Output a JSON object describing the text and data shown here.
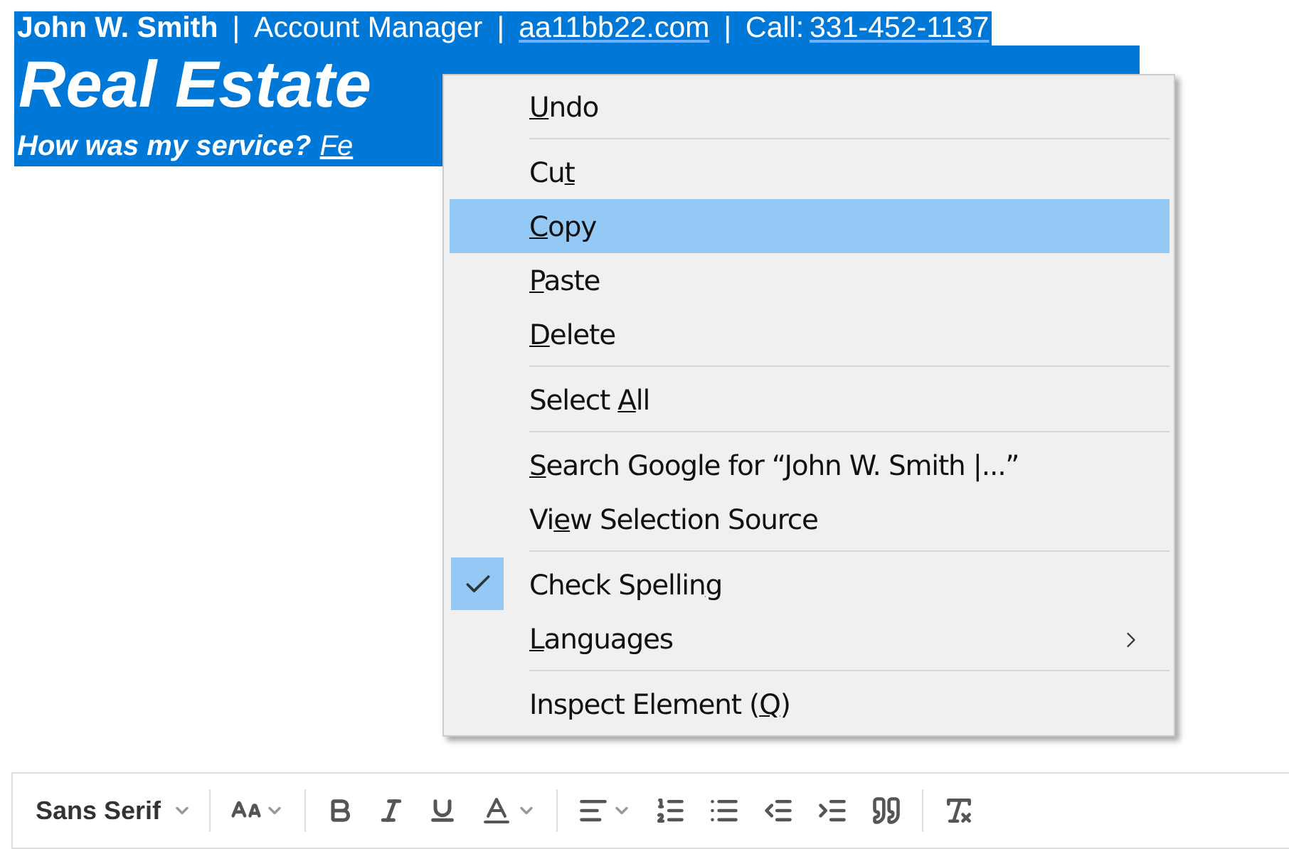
{
  "signature": {
    "line_1": [
      {
        "kind": "name",
        "text": "John W. Smith"
      },
      {
        "kind": "separator",
        "text": "|"
      },
      {
        "kind": "plain",
        "text": "Account Manager"
      },
      {
        "kind": "separator",
        "text": "|"
      },
      {
        "kind": "link",
        "text": "aa11bb22.com"
      },
      {
        "kind": "separator",
        "text": "|"
      },
      {
        "kind": "plain",
        "text": "Call:"
      },
      {
        "kind": "link",
        "text": "331-452-1137"
      }
    ],
    "company": "Real Estate",
    "line_3": [
      {
        "kind": "question",
        "text": "How was my service?"
      },
      {
        "kind": "link",
        "text": "Fe"
      }
    ]
  },
  "context_menu": {
    "groups": [
      [
        {
          "key": "U",
          "after": "ndo",
          "selected": false
        }
      ],
      [
        {
          "before": "Cu",
          "key": "t",
          "selected": false
        },
        {
          "key": "C",
          "after": "opy",
          "selected": true
        },
        {
          "key": "P",
          "after": "aste",
          "selected": false
        },
        {
          "key": "D",
          "after": "elete",
          "selected": false
        }
      ],
      [
        {
          "before": "Select ",
          "key": "A",
          "after": "ll",
          "selected": false
        }
      ],
      [
        {
          "key": "S",
          "after": "earch Google for “John W. Smith |...”",
          "selected": false
        },
        {
          "before": "Vi",
          "key": "e",
          "after": "w Selection Source",
          "selected": false
        }
      ],
      [
        {
          "before": "Check Spellin",
          "key": "g",
          "selected": false,
          "checked": true
        },
        {
          "key": "L",
          "after": "anguages",
          "selected": false,
          "submenu": true
        }
      ],
      [
        {
          "before": "Inspect Element (",
          "key": "Q",
          "after": ")",
          "selected": false
        }
      ]
    ]
  },
  "toolbar": {
    "font": "Sans Serif"
  }
}
